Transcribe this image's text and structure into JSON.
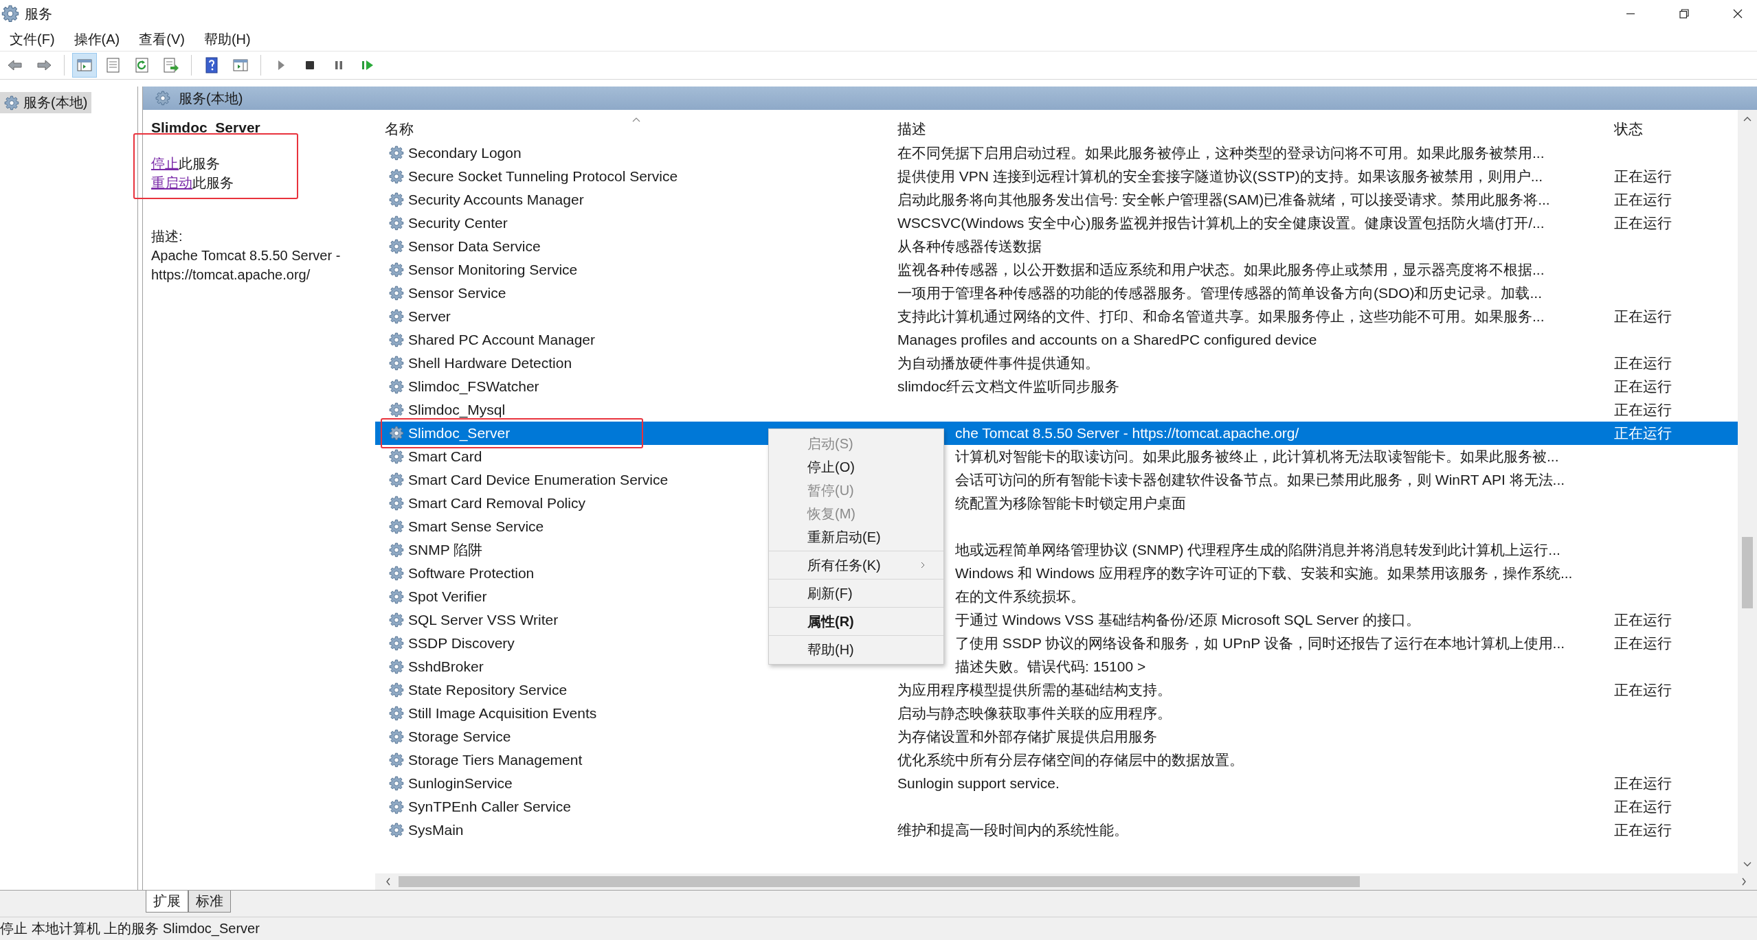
{
  "window": {
    "title": "服务"
  },
  "menu_bar": [
    "文件(F)",
    "操作(A)",
    "查看(V)",
    "帮助(H)"
  ],
  "toolbar": [
    [
      {
        "kind": "back",
        "selected": false
      },
      {
        "kind": "forward",
        "selected": false
      }
    ],
    [
      {
        "kind": "tree",
        "selected": true
      },
      {
        "kind": "properties",
        "selected": false
      },
      {
        "kind": "refresh",
        "selected": false
      },
      {
        "kind": "export",
        "selected": false
      }
    ],
    [
      {
        "kind": "help",
        "selected": false
      },
      {
        "kind": "pane",
        "selected": false
      }
    ],
    [
      {
        "kind": "play",
        "selected": false
      },
      {
        "kind": "stop",
        "selected": false
      },
      {
        "kind": "pause",
        "selected": false
      },
      {
        "kind": "resume",
        "selected": false
      }
    ]
  ],
  "tree": [
    {
      "label": "服务(本地)",
      "selected": true
    }
  ],
  "pane": {
    "title": "服务(本地)"
  },
  "detail": {
    "name": "Slimdoc_Server",
    "actions_highlighted": true,
    "actions": [
      {
        "link": "停止",
        "text": "此服务"
      },
      {
        "link": "重启动",
        "text": "此服务"
      }
    ],
    "description_label": "描述:",
    "description": "Apache Tomcat 8.5.50 Server - https://tomcat.apache.org/"
  },
  "table": {
    "columns": [
      {
        "label": "名称",
        "sorted": true
      },
      {
        "label": "描述",
        "sorted": false
      },
      {
        "label": "状态",
        "sorted": false
      }
    ],
    "rows": [
      {
        "name": "Secondary Logon",
        "description": "在不同凭据下启用启动过程。如果此服务被停止，这种类型的登录访问将不可用。如果此服务被禁用...",
        "selected": false,
        "highlighted": false
      },
      {
        "name": "Secure Socket Tunneling Protocol Service",
        "description": "提供使用 VPN 连接到远程计算机的安全套接字隧道协议(SSTP)的支持。如果该服务被禁用，则用户...",
        "status": "正在运行",
        "selected": false,
        "highlighted": false
      },
      {
        "name": "Security Accounts Manager",
        "description": "启动此服务将向其他服务发出信号: 安全帐户管理器(SAM)已准备就绪，可以接受请求。禁用此服务将...",
        "status": "正在运行",
        "selected": false,
        "highlighted": false
      },
      {
        "name": "Security Center",
        "description": "WSCSVC(Windows 安全中心)服务监视并报告计算机上的安全健康设置。健康设置包括防火墙(打开/...",
        "status": "正在运行",
        "selected": false,
        "highlighted": false
      },
      {
        "name": "Sensor Data Service",
        "description": "从各种传感器传送数据",
        "selected": false,
        "highlighted": false
      },
      {
        "name": "Sensor Monitoring Service",
        "description": "监视各种传感器，以公开数据和适应系统和用户状态。如果此服务停止或禁用，显示器亮度将不根据...",
        "selected": false,
        "highlighted": false
      },
      {
        "name": "Sensor Service",
        "description": "一项用于管理各种传感器的功能的传感器服务。管理传感器的简单设备方向(SDO)和历史记录。加载...",
        "selected": false,
        "highlighted": false
      },
      {
        "name": "Server",
        "description": "支持此计算机通过网络的文件、打印、和命名管道共享。如果服务停止，这些功能不可用。如果服务...",
        "status": "正在运行",
        "selected": false,
        "highlighted": false
      },
      {
        "name": "Shared PC Account Manager",
        "description": "Manages profiles and accounts on a SharedPC configured device",
        "selected": false,
        "highlighted": false
      },
      {
        "name": "Shell Hardware Detection",
        "description": "为自动播放硬件事件提供通知。",
        "status": "正在运行",
        "selected": false,
        "highlighted": false
      },
      {
        "name": "Slimdoc_FSWatcher",
        "description": "slimdoc纤云文档文件监听同步服务",
        "status": "正在运行",
        "selected": false,
        "highlighted": false
      },
      {
        "name": "Slimdoc_Mysql",
        "status": "正在运行",
        "selected": false,
        "highlighted": false
      },
      {
        "name": "Slimdoc_Server",
        "description": "che Tomcat 8.5.50 Server - https://tomcat.apache.org/",
        "status": "正在运行",
        "selected": true,
        "highlighted": true
      },
      {
        "name": "Smart Card",
        "description": "计算机对智能卡的取读访问。如果此服务被终止，此计算机将无法取读智能卡。如果此服务被...",
        "selected": false,
        "highlighted": false
      },
      {
        "name": "Smart Card Device Enumeration Service",
        "description": "会话可访问的所有智能卡读卡器创建软件设备节点。如果已禁用此服务，则 WinRT API 将无法...",
        "selected": false,
        "highlighted": false
      },
      {
        "name": "Smart Card Removal Policy",
        "description": "统配置为移除智能卡时锁定用户桌面",
        "selected": false,
        "highlighted": false
      },
      {
        "name": "Smart Sense Service",
        "selected": false,
        "highlighted": false
      },
      {
        "name": "SNMP 陷阱",
        "description": "地或远程简单网络管理协议 (SNMP) 代理程序生成的陷阱消息并将消息转发到此计算机上运行...",
        "selected": false,
        "highlighted": false
      },
      {
        "name": "Software Protection",
        "description": "Windows 和 Windows 应用程序的数字许可证的下载、安装和实施。如果禁用该服务，操作系统...",
        "selected": false,
        "highlighted": false
      },
      {
        "name": "Spot Verifier",
        "description": "在的文件系统损坏。",
        "selected": false,
        "highlighted": false
      },
      {
        "name": "SQL Server VSS Writer",
        "description": "于通过 Windows VSS 基础结构备份/还原 Microsoft SQL Server 的接口。",
        "status": "正在运行",
        "selected": false,
        "highlighted": false
      },
      {
        "name": "SSDP Discovery",
        "description": "了使用 SSDP 协议的网络设备和服务，如 UPnP 设备，同时还报告了运行在本地计算机上使用...",
        "status": "正在运行",
        "selected": false,
        "highlighted": false
      },
      {
        "name": "SshdBroker",
        "description": "描述失败。错误代码: 15100 >",
        "selected": false,
        "highlighted": false
      },
      {
        "name": "State Repository Service",
        "description": "为应用程序模型提供所需的基础结构支持。",
        "status": "正在运行",
        "selected": false,
        "highlighted": false
      },
      {
        "name": "Still Image Acquisition Events",
        "description": "启动与静态映像获取事件关联的应用程序。",
        "selected": false,
        "highlighted": false
      },
      {
        "name": "Storage Service",
        "description": "为存储设置和外部存储扩展提供启用服务",
        "selected": false,
        "highlighted": false
      },
      {
        "name": "Storage Tiers Management",
        "description": "优化系统中所有分层存储空间的存储层中的数据放置。",
        "selected": false,
        "highlighted": false
      },
      {
        "name": "SunloginService",
        "description": "Sunlogin support service.",
        "status": "正在运行",
        "selected": false,
        "highlighted": false
      },
      {
        "name": "SynTPEnh Caller Service",
        "status": "正在运行",
        "selected": false,
        "highlighted": false
      },
      {
        "name": "SysMain",
        "description": "维护和提高一段时间内的系统性能。",
        "status": "正在运行",
        "selected": false,
        "highlighted": false
      }
    ]
  },
  "context_menu": {
    "groups": [
      [
        {
          "label": "启动(S)",
          "disabled": true,
          "default": false,
          "submenu": false
        },
        {
          "label": "停止(O)",
          "disabled": false,
          "default": false,
          "submenu": false
        },
        {
          "label": "暂停(U)",
          "disabled": true,
          "default": false,
          "submenu": false
        },
        {
          "label": "恢复(M)",
          "disabled": true,
          "default": false,
          "submenu": false
        },
        {
          "label": "重新启动(E)",
          "disabled": false,
          "default": false,
          "submenu": false
        }
      ],
      [
        {
          "label": "所有任务(K)",
          "disabled": false,
          "default": false,
          "submenu": true
        }
      ],
      [
        {
          "label": "刷新(F)",
          "disabled": false,
          "default": false,
          "submenu": false
        }
      ],
      [
        {
          "label": "属性(R)",
          "disabled": false,
          "default": true,
          "submenu": false
        }
      ],
      [
        {
          "label": "帮助(H)",
          "disabled": false,
          "default": false,
          "submenu": false
        }
      ]
    ]
  },
  "tabs": [
    {
      "label": "扩展",
      "selected": true
    },
    {
      "label": "标准",
      "selected": false
    }
  ],
  "status_bar": "停止 本地计算机 上的服务 Slimdoc_Server"
}
